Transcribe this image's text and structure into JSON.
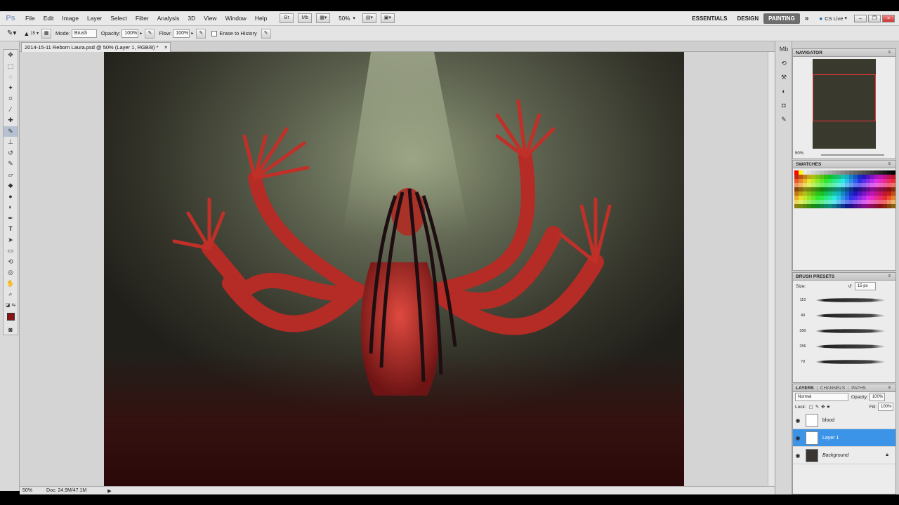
{
  "menubar": {
    "logo": "Ps",
    "menus": [
      "File",
      "Edit",
      "Image",
      "Layer",
      "Select",
      "Filter",
      "Analysis",
      "3D",
      "View",
      "Window",
      "Help"
    ],
    "zoom": "50%",
    "workspaces": [
      "ESSENTIALS",
      "DESIGN",
      "PAINTING"
    ],
    "active_workspace": "PAINTING",
    "more": "»",
    "cslive": "CS Live"
  },
  "options": {
    "brush_size": "15",
    "mode_label": "Mode:",
    "mode_value": "Brush",
    "opacity_label": "Opacity:",
    "opacity_value": "100%",
    "flow_label": "Flow:",
    "flow_value": "100%",
    "erase_label": "Erase to History"
  },
  "document": {
    "tab_title": "2014-15-11 Reborn Laura.psd @ 50% (Layer 1, RGB/8) *",
    "close": "×"
  },
  "statusbar": {
    "zoom": "50%",
    "doc_info": "Doc: 24.9M/47.1M"
  },
  "navigator": {
    "title": "NAVIGATOR",
    "zoom": "50%"
  },
  "swatches": {
    "title": "SWATCHES"
  },
  "brush_presets": {
    "title": "BRUSH PRESETS",
    "size_label": "Size:",
    "size_value": "15 px",
    "brushes": [
      {
        "size": "110"
      },
      {
        "size": "49"
      },
      {
        "size": "300"
      },
      {
        "size": "256"
      },
      {
        "size": "79"
      }
    ]
  },
  "layers": {
    "tabs": [
      "LAYERS",
      "CHANNELS",
      "PATHS"
    ],
    "blend_mode": "Normal",
    "opacity_label": "Opacity:",
    "opacity_value": "100%",
    "lock_label": "Lock:",
    "fill_label": "Fill:",
    "fill_value": "100%",
    "items": [
      {
        "name": "blood",
        "selected": false
      },
      {
        "name": "Layer 1",
        "selected": true
      },
      {
        "name": "Background",
        "selected": false
      }
    ]
  },
  "colors": {
    "foreground": "#8a1414",
    "selection": "#3c94e8"
  }
}
